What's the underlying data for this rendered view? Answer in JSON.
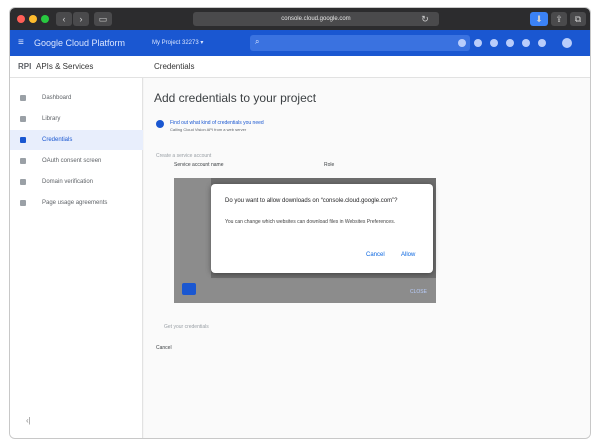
{
  "browser": {
    "url": "console.cloud.google.com"
  },
  "gcp": {
    "brand": "Google Cloud Platform",
    "project": "My Project 32273"
  },
  "section": {
    "name": "APIs & Services",
    "page": "Credentials"
  },
  "sidebar": {
    "items": [
      {
        "label": "Dashboard"
      },
      {
        "label": "Library"
      },
      {
        "label": "Credentials"
      },
      {
        "label": "OAuth consent screen"
      },
      {
        "label": "Domain verification"
      },
      {
        "label": "Page usage agreements"
      }
    ]
  },
  "main": {
    "title": "Add credentials to your project",
    "step1_title": "Find out what kind of credentials you need",
    "step1_sub": "Calling Cloud Vision API from a web server",
    "step2_title": "Create a service account",
    "service_account_label": "Service account name",
    "role_label": "Role",
    "step3_title": "Get your credentials",
    "cancel_label": "Cancel",
    "close_label": "CLOSE"
  },
  "dialog": {
    "title": "Do you want to allow downloads on “console.cloud.google.com”?",
    "body": "You can change which websites can download files in Websites Preferences.",
    "cancel": "Cancel",
    "allow": "Allow"
  },
  "colors": {
    "gcp_blue": "#1a57d1",
    "dialog_button": "#0a66e0"
  }
}
